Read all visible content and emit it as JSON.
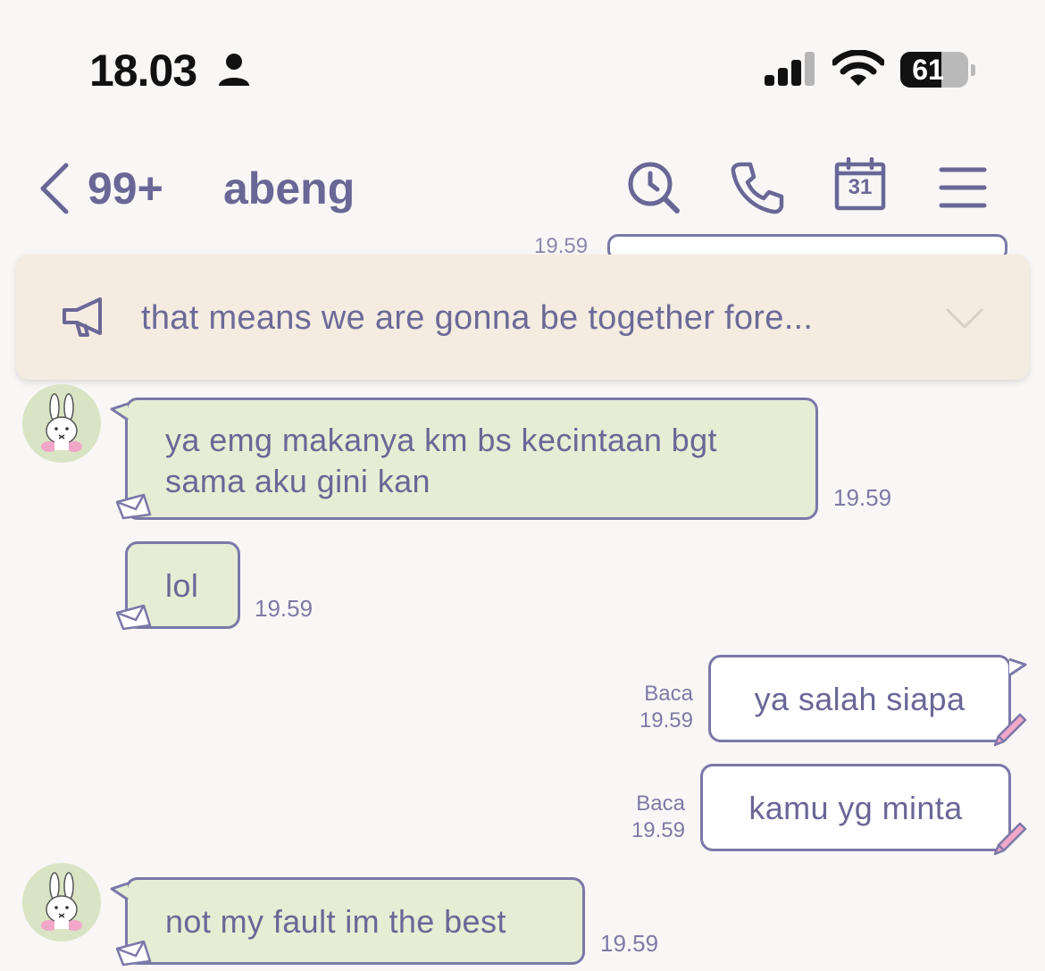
{
  "status_bar": {
    "time": "18.03",
    "battery": "61",
    "battery_level": 0.61
  },
  "header": {
    "unread": "99+",
    "contact": "abeng",
    "icons": [
      "back-icon",
      "search-icon",
      "phone-icon",
      "calendar-icon",
      "menu-icon"
    ],
    "calendar_day": "31"
  },
  "announcement": {
    "text": "that means we are gonna be together fore..."
  },
  "chat": {
    "messages": [
      {
        "side": "in",
        "lines": [
          "ya emg makanya km bs kecintaan bgt",
          "sama aku gini kan"
        ],
        "time": "19.59"
      },
      {
        "side": "in",
        "lines": [
          "lol"
        ],
        "time": "19.59"
      },
      {
        "side": "out",
        "text": "ya salah siapa",
        "read": "Baca",
        "time": "19.59"
      },
      {
        "side": "out",
        "text": "kamu yg minta",
        "read": "Baca",
        "time": "19.59"
      },
      {
        "side": "in",
        "lines": [
          "not my fault im the best"
        ],
        "time": "19.59"
      }
    ]
  },
  "colors": {
    "accent": "#6b6899",
    "incoming_bubble": "#e6edd4",
    "outgoing_bubble": "#ffffff",
    "banner": "#f4ece0",
    "background": "#f9f7f6",
    "pencil": "#f2a6c8"
  }
}
